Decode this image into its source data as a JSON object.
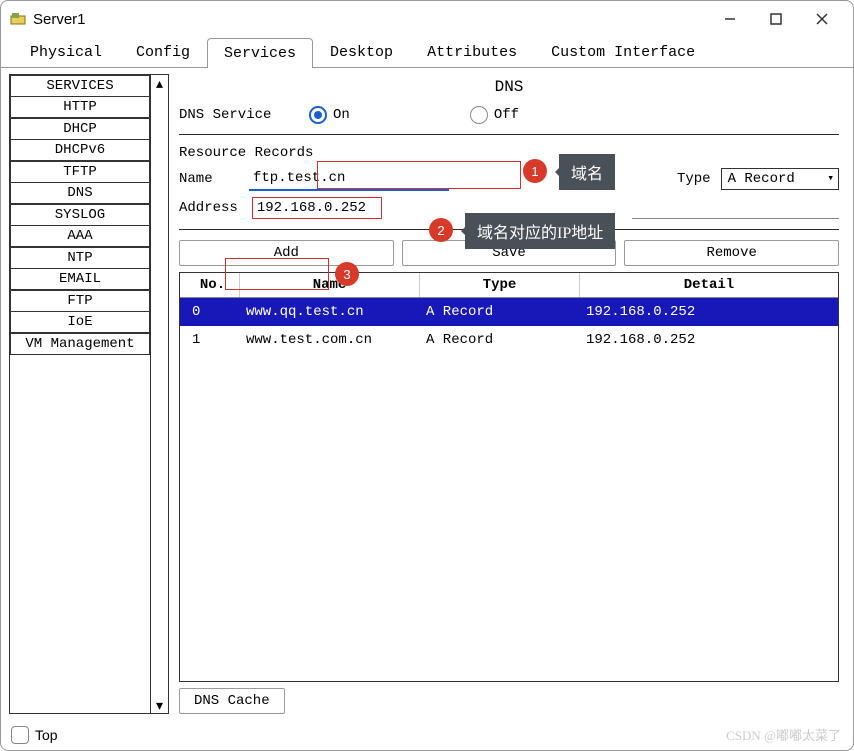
{
  "window": {
    "title": "Server1"
  },
  "tabs": [
    "Physical",
    "Config",
    "Services",
    "Desktop",
    "Attributes",
    "Custom Interface"
  ],
  "active_tab": "Services",
  "sidebar": {
    "items": [
      "SERVICES",
      "HTTP",
      "DHCP",
      "DHCPv6",
      "TFTP",
      "DNS",
      "SYSLOG",
      "AAA",
      "NTP",
      "EMAIL",
      "FTP",
      "IoE",
      "VM Management"
    ],
    "active": "DNS"
  },
  "dns": {
    "heading": "DNS",
    "service_label": "DNS Service",
    "on_label": "On",
    "off_label": "Off",
    "service_state": "On",
    "resource_records_label": "Resource Records",
    "name_label": "Name",
    "name_value": "ftp.test.cn",
    "type_label": "Type",
    "type_value": "A Record",
    "address_label": "Address",
    "address_value": "192.168.0.252",
    "buttons": {
      "add": "Add",
      "save": "Save",
      "remove": "Remove"
    },
    "table": {
      "headers": {
        "no": "No.",
        "name": "Name",
        "type": "Type",
        "detail": "Detail"
      },
      "rows": [
        {
          "no": "0",
          "name": "www.qq.test.cn",
          "type": "A Record",
          "detail": "192.168.0.252",
          "selected": true
        },
        {
          "no": "1",
          "name": "www.test.com.cn",
          "type": "A Record",
          "detail": "192.168.0.252",
          "selected": false
        }
      ]
    },
    "cache_button": "DNS Cache"
  },
  "annotations": {
    "badge1": "1",
    "tip1": "域名",
    "badge2": "2",
    "tip2": "域名对应的IP地址",
    "badge3": "3"
  },
  "footer": {
    "top_label": "Top"
  },
  "watermark": "CSDN @嘟嘟太菜了"
}
